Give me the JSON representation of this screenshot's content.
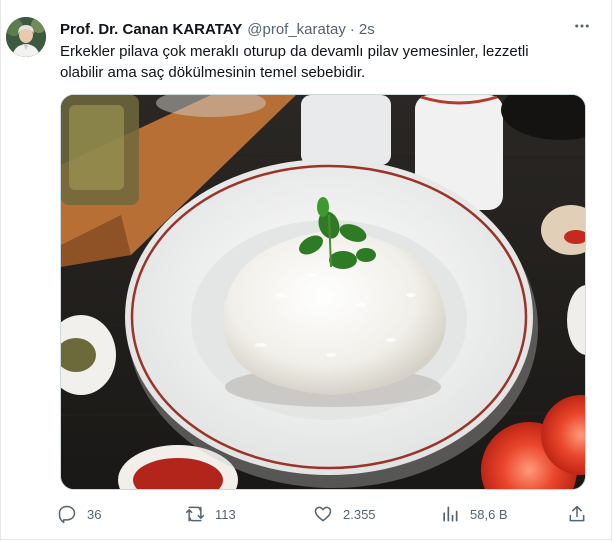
{
  "tweet": {
    "author": {
      "display_name": "Prof. Dr. Canan KARATAY",
      "handle": "@prof_karatay",
      "separator": "·",
      "time": "2s"
    },
    "text": "Erkekler pilava çok meraklı oturup da devamlı pilav yemesinler, lezzetli olabilir ama saç dökülmesinin temel sebebidir.",
    "media_icon": "rice-plate-photo",
    "actions": {
      "replies": "36",
      "reposts": "113",
      "likes": "2.355",
      "views": "58,6 B"
    }
  },
  "colors": {
    "text_primary": "#0f1419",
    "text_secondary": "#536471",
    "border": "#cfd9de"
  },
  "icons": [
    "more-icon",
    "reply-icon",
    "repost-icon",
    "like-icon",
    "views-icon",
    "share-icon"
  ]
}
